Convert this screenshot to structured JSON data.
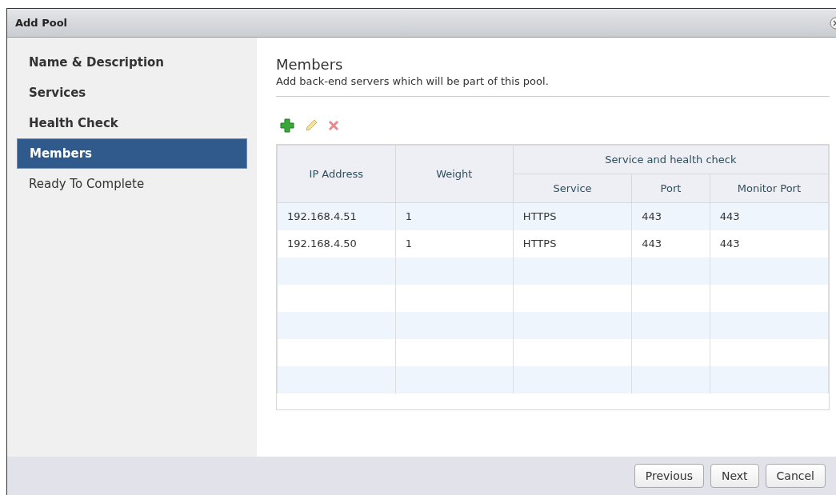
{
  "window": {
    "title": "Add Pool"
  },
  "steps": [
    {
      "label": "Name & Description",
      "visited": true,
      "selected": false
    },
    {
      "label": "Services",
      "visited": true,
      "selected": false
    },
    {
      "label": "Health Check",
      "visited": true,
      "selected": false
    },
    {
      "label": "Members",
      "visited": true,
      "selected": true
    },
    {
      "label": "Ready To Complete",
      "visited": false,
      "selected": false
    }
  ],
  "page": {
    "title": "Members",
    "description": "Add back-end servers which will be part of this pool."
  },
  "table": {
    "columns": [
      "IP Address",
      "Weight"
    ],
    "group": {
      "title": "Service and health check",
      "columns": [
        "Service",
        "Port",
        "Monitor Port"
      ]
    },
    "rows": [
      [
        "192.168.4.51",
        "1",
        "HTTPS",
        "443",
        "443"
      ],
      [
        "192.168.4.50",
        "1",
        "HTTPS",
        "443",
        "443"
      ]
    ]
  },
  "buttons": [
    "Previous",
    "Next",
    "Cancel"
  ]
}
